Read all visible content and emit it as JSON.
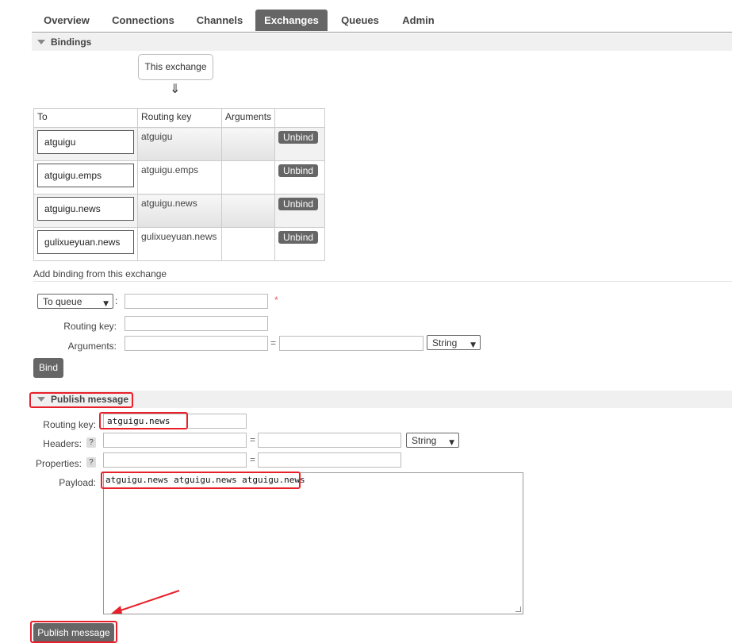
{
  "tabs": [
    {
      "label": "Overview"
    },
    {
      "label": "Connections"
    },
    {
      "label": "Channels"
    },
    {
      "label": "Exchanges"
    },
    {
      "label": "Queues"
    },
    {
      "label": "Admin"
    }
  ],
  "active_tab": "Exchanges",
  "bindings_section": {
    "title": "Bindings",
    "source_label": "This exchange",
    "arrow": "⇓",
    "columns": [
      "To",
      "Routing key",
      "Arguments"
    ],
    "rows": [
      {
        "to": "atguigu",
        "routing_key": "atguigu",
        "arguments": "",
        "action": "Unbind"
      },
      {
        "to": "atguigu.emps",
        "routing_key": "atguigu.emps",
        "arguments": "",
        "action": "Unbind"
      },
      {
        "to": "atguigu.news",
        "routing_key": "atguigu.news",
        "arguments": "",
        "action": "Unbind"
      },
      {
        "to": "gulixueyuan.news",
        "routing_key": "gulixueyuan.news",
        "arguments": "",
        "action": "Unbind"
      }
    ]
  },
  "add_binding": {
    "title": "Add binding from this exchange",
    "destination_type": "To queue",
    "destination_colon": ":",
    "required_mark": "*",
    "routing_key_label": "Routing key:",
    "arguments_label": "Arguments:",
    "equals": "=",
    "argument_type": "String",
    "bind_button": "Bind"
  },
  "publish_section": {
    "title": "Publish message",
    "routing_key_label": "Routing key:",
    "routing_key_value": "atguigu.news",
    "headers_label": "Headers:",
    "properties_label": "Properties:",
    "help_mark": "?",
    "equals": "=",
    "header_type": "String",
    "payload_label": "Payload:",
    "payload_value": "atguigu.news atguigu.news atguigu.news",
    "publish_button": "Publish message"
  },
  "colors": {
    "annotation_red": "#e8202a",
    "button_gray": "#666666",
    "active_tab_bg": "#666666"
  }
}
